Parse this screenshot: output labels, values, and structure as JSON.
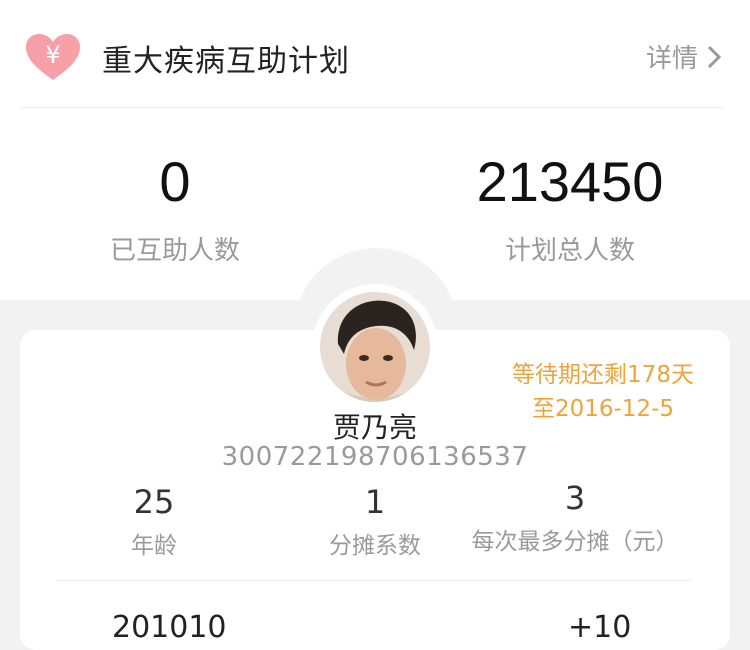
{
  "header": {
    "title": "重大疾病互助计划",
    "detail_label": "详情",
    "heart_icon": "heart-yen-icon",
    "heart_color": "#f8a0a8"
  },
  "stats": {
    "helped": {
      "value": "0",
      "label": "已互助人数"
    },
    "total": {
      "value": "213450",
      "label": "计划总人数"
    }
  },
  "member": {
    "name": "贾乃亮",
    "id_number": "300722198706136537",
    "wait_line1": "等待期还剩178天",
    "wait_line2": "至2016-12-5",
    "wait_color": "#f0a33a",
    "age": {
      "value": "25",
      "label": "年龄"
    },
    "coefficient": {
      "value": "1",
      "label": "分摊系数"
    },
    "max_share": {
      "value": "3",
      "label": "每次最多分摊（元）"
    }
  },
  "bottom": {
    "left_partial": "201010",
    "right_partial": "+10"
  }
}
